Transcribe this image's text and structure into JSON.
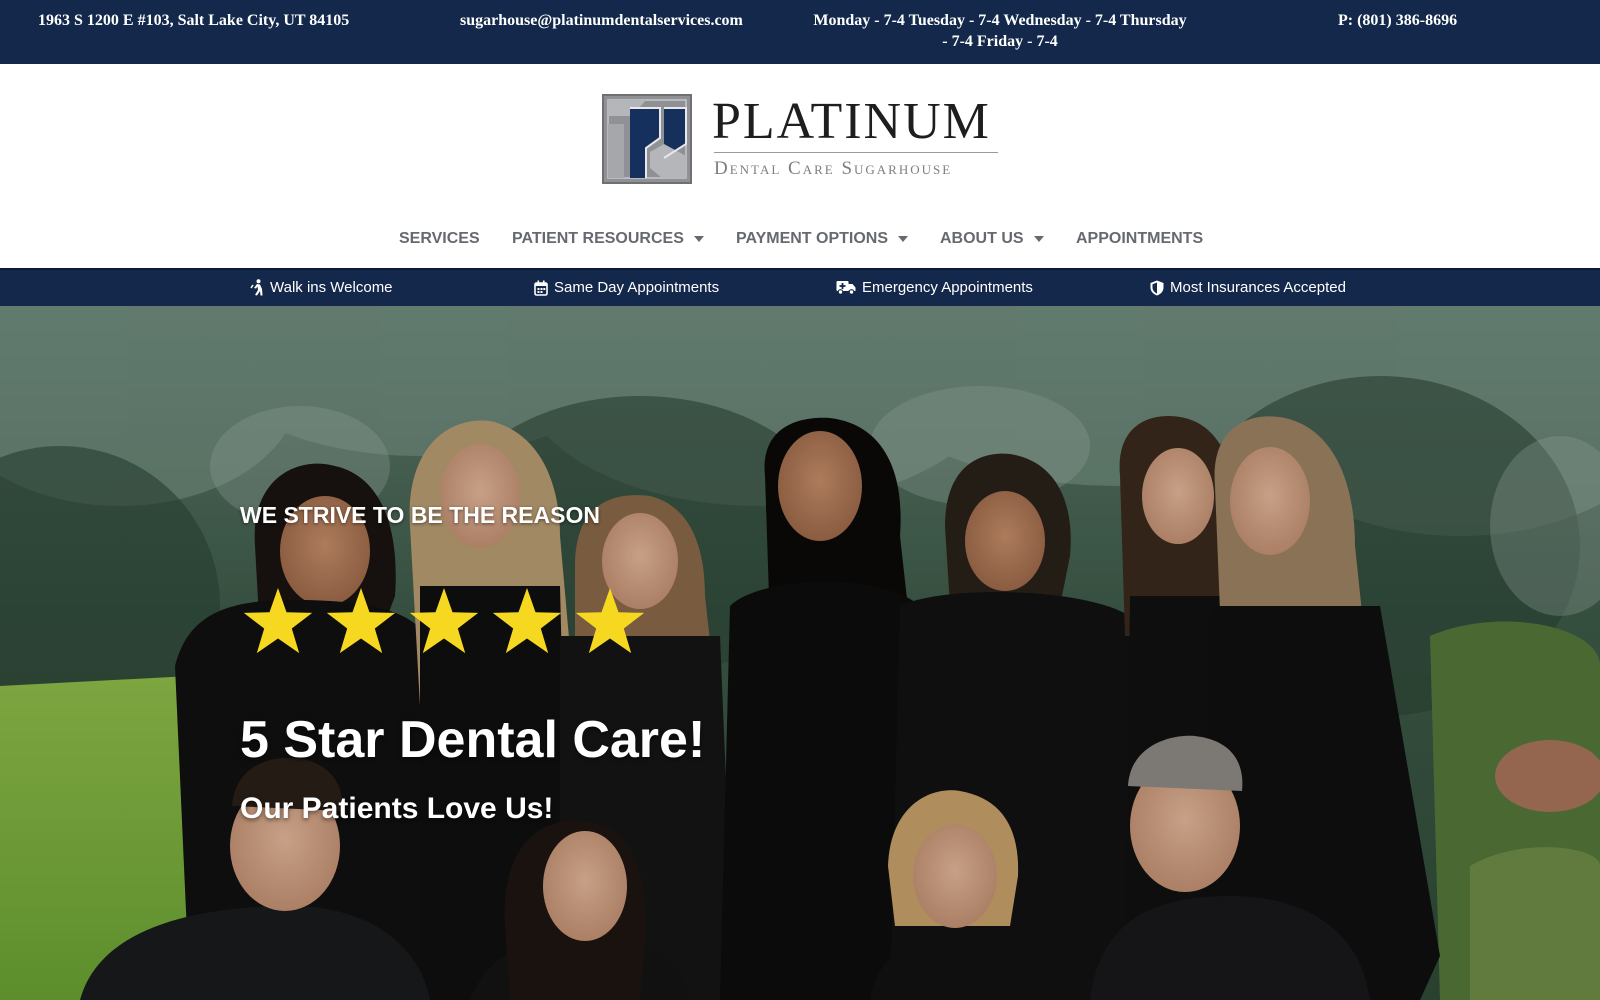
{
  "topbar": {
    "address": "1963 S 1200 E #103, Salt Lake City, UT 84105",
    "email": "sugarhouse@platinumdentalservices.com",
    "hours_line1": "Monday - 7-4 Tuesday - 7-4 Wednesday - 7-4 Thursday",
    "hours_line2": "- 7-4 Friday - 7-4",
    "phone": "P: (801) 386-8696"
  },
  "logo": {
    "name": "PLATINUM",
    "subtitle": "Dental Care Sugarhouse"
  },
  "nav": {
    "items": [
      {
        "label": "SERVICES",
        "has_dropdown": false
      },
      {
        "label": "PATIENT RESOURCES",
        "has_dropdown": true
      },
      {
        "label": "PAYMENT OPTIONS",
        "has_dropdown": true
      },
      {
        "label": "ABOUT US",
        "has_dropdown": true
      },
      {
        "label": "APPOINTMENTS",
        "has_dropdown": false
      }
    ]
  },
  "features": [
    {
      "icon": "walking-person-icon",
      "label": "Walk ins Welcome"
    },
    {
      "icon": "calendar-icon",
      "label": "Same Day Appointments"
    },
    {
      "icon": "ambulance-icon",
      "label": "Emergency Appointments"
    },
    {
      "icon": "shield-icon",
      "label": "Most Insurances Accepted"
    }
  ],
  "hero": {
    "eyebrow": "WE STRIVE TO BE THE REASON",
    "rating": 5,
    "title": "5 Star Dental Care!",
    "subtitle": "Our Patients Love Us!"
  },
  "colors": {
    "navy": "#13284a",
    "nav_text": "#666a70",
    "star": "#f5d81f",
    "white": "#ffffff"
  }
}
